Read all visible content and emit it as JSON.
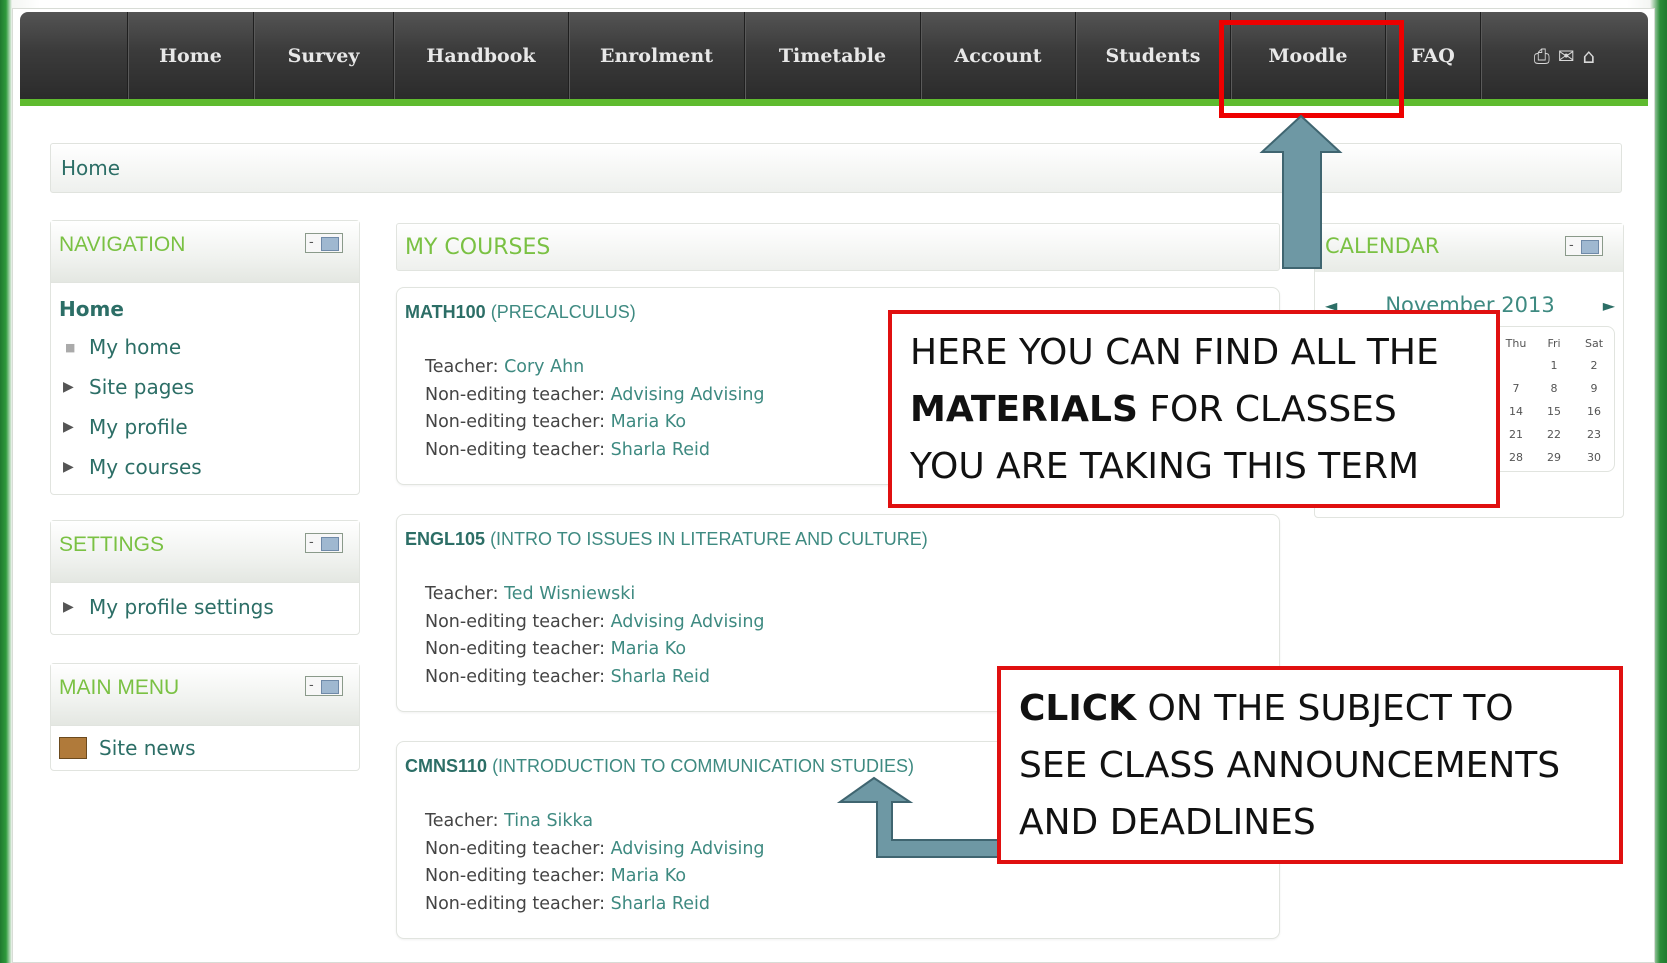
{
  "nav": {
    "items": [
      "Home",
      "Survey",
      "Handbook",
      "Enrolment",
      "Timetable",
      "Account",
      "Students",
      "Moodle",
      "FAQ"
    ],
    "icons": [
      "printer-icon",
      "mail-icon",
      "home-icon"
    ]
  },
  "breadcrumb": {
    "home": "Home"
  },
  "navigation": {
    "title": "NAVIGATION",
    "toggle": "-",
    "home": "Home",
    "my_home": "My home",
    "site_pages": "Site pages",
    "my_profile": "My profile",
    "my_courses": "My courses"
  },
  "settings": {
    "title": "SETTINGS",
    "toggle": "-",
    "my_profile_settings": "My profile settings"
  },
  "main_menu": {
    "title": "MAIN MENU",
    "toggle": "-",
    "site_news": "Site news"
  },
  "courses": {
    "header": "MY COURSES",
    "teacher_label": "Teacher:",
    "noned_label": "Non-editing teacher:",
    "list": [
      {
        "code": "MATH100",
        "name": "(PRECALCULUS)",
        "teacher": "Cory Ahn",
        "noned": [
          "Advising Advising",
          "Maria Ko",
          "Sharla Reid"
        ]
      },
      {
        "code": "ENGL105",
        "name": "(INTRO TO ISSUES IN LITERATURE AND CULTURE)",
        "teacher": "Ted Wisniewski",
        "noned": [
          "Advising Advising",
          "Maria Ko",
          "Sharla Reid"
        ]
      },
      {
        "code": "CMNS110",
        "name": "(INTRODUCTION TO COMMUNICATION STUDIES)",
        "teacher": "Tina Sikka",
        "noned": [
          "Advising Advising",
          "Maria Ko",
          "Sharla Reid"
        ]
      }
    ]
  },
  "calendar": {
    "title": "CALENDAR",
    "toggle": "-",
    "month": "November 2013",
    "prev": "◄",
    "next": "►",
    "visible_columns": [
      {
        "hd": "Thu",
        "days": [
          "",
          "7",
          "14",
          "21",
          "28"
        ]
      },
      {
        "hd": "Fri",
        "days": [
          "1",
          "8",
          "15",
          "22",
          "29"
        ]
      },
      {
        "hd": "Sat",
        "days": [
          "2",
          "9",
          "16",
          "23",
          "30"
        ]
      }
    ]
  },
  "annotations": {
    "callout1": {
      "line1": "HERE YOU CAN FIND ALL THE",
      "line2_bold": "MATERIALS",
      "line2_rest": " FOR CLASSES",
      "line3": "YOU ARE TAKING THIS TERM"
    },
    "callout2": {
      "line1_bold": "CLICK",
      "line1_rest": " ON THE SUBJECT TO",
      "line2": "SEE CLASS ANNOUNCEMENTS",
      "line3": "AND DEADLINES"
    },
    "arrow_color": "#6e98a4",
    "highlight_color": "#ee0000"
  }
}
